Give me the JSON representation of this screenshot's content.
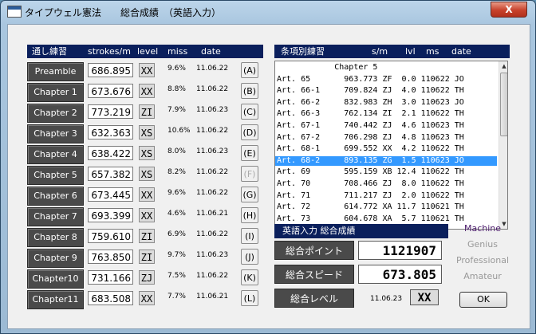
{
  "window": {
    "title": "タイプウェル憲法　　総合成績　（英語入力）",
    "close_glyph": "X"
  },
  "left_panel": {
    "headers": [
      "通し練習",
      "strokes/m",
      "level",
      "miss",
      "date"
    ],
    "rows": [
      {
        "label": "Preamble",
        "strokes": "686.895",
        "level": "XX",
        "miss": "9.6%",
        "date": "11.06.22",
        "key": "(A)",
        "key_enabled": true
      },
      {
        "label": "Chapter 1",
        "strokes": "673.676",
        "level": "XX",
        "miss": "8.8%",
        "date": "11.06.22",
        "key": "(B)",
        "key_enabled": true
      },
      {
        "label": "Chapter 2",
        "strokes": "773.219",
        "level": "ZI",
        "miss": "7.9%",
        "date": "11.06.23",
        "key": "(C)",
        "key_enabled": true
      },
      {
        "label": "Chapter 3",
        "strokes": "632.363",
        "level": "XS",
        "miss": "10.6%",
        "date": "11.06.22",
        "key": "(D)",
        "key_enabled": true
      },
      {
        "label": "Chapter 4",
        "strokes": "638.422",
        "level": "XS",
        "miss": "8.0%",
        "date": "11.06.23",
        "key": "(E)",
        "key_enabled": true
      },
      {
        "label": "Chapter 5",
        "strokes": "657.382",
        "level": "XS",
        "miss": "8.2%",
        "date": "11.06.22",
        "key": "(F)",
        "key_enabled": false
      },
      {
        "label": "Chapter 6",
        "strokes": "673.445",
        "level": "XX",
        "miss": "9.6%",
        "date": "11.06.22",
        "key": "(G)",
        "key_enabled": true
      },
      {
        "label": "Chapter 7",
        "strokes": "693.399",
        "level": "XX",
        "miss": "4.6%",
        "date": "11.06.21",
        "key": "(H)",
        "key_enabled": true
      },
      {
        "label": "Chapter 8",
        "strokes": "759.610",
        "level": "ZI",
        "miss": "6.9%",
        "date": "11.06.22",
        "key": "(I)",
        "key_enabled": true
      },
      {
        "label": "Chapter 9",
        "strokes": "763.850",
        "level": "ZI",
        "miss": "9.7%",
        "date": "11.06.23",
        "key": "(J)",
        "key_enabled": true
      },
      {
        "label": "Chapter10",
        "strokes": "731.166",
        "level": "ZJ",
        "miss": "7.5%",
        "date": "11.06.22",
        "key": "(K)",
        "key_enabled": true
      },
      {
        "label": "Chapter11",
        "strokes": "683.508",
        "level": "XX",
        "miss": "7.7%",
        "date": "11.06.21",
        "key": "(L)",
        "key_enabled": true
      }
    ]
  },
  "right_panel": {
    "headers": [
      "条項別練習",
      "s/m",
      "lvl",
      "ms",
      "date"
    ],
    "list": [
      {
        "text": "            Chapter 5",
        "selected": false
      },
      {
        "text": "Art. 65       963.773 ZF  0.0 110622 JO",
        "selected": false
      },
      {
        "text": "Art. 66-1     709.824 ZJ  4.0 110622 TH",
        "selected": false
      },
      {
        "text": "Art. 66-2     832.983 ZH  3.0 110623 JO",
        "selected": false
      },
      {
        "text": "Art. 66-3     762.134 ZI  2.1 110622 TH",
        "selected": false
      },
      {
        "text": "Art. 67-1     740.442 ZJ  4.6 110623 TH",
        "selected": false
      },
      {
        "text": "Art. 67-2     706.298 ZJ  4.8 110623 TH",
        "selected": false
      },
      {
        "text": "Art. 68-1     699.552 XX  4.2 110622 TH",
        "selected": false
      },
      {
        "text": "Art. 68-2     893.135 ZG  1.5 110623 JO",
        "selected": true
      },
      {
        "text": "Art. 69       595.159 XB 12.4 110622 TH",
        "selected": false
      },
      {
        "text": "Art. 70       708.466 ZJ  8.0 110622 TH",
        "selected": false
      },
      {
        "text": "Art. 71       711.217 ZJ  2.0 110622 TH",
        "selected": false
      },
      {
        "text": "Art. 72       614.772 XA 11.7 110621 TH",
        "selected": false
      },
      {
        "text": "Art. 73       604.678 XA  5.7 110621 TH",
        "selected": false
      }
    ],
    "scroll_up_glyph": "▲",
    "scroll_down_glyph": "▼"
  },
  "summary": {
    "title": "英語入力 総合成績",
    "points_label": "総合ポイント",
    "points_value": "1121907",
    "speed_label": "総合スピード",
    "speed_value": "673.805",
    "level_label": "総合レベル",
    "level_date": "11.06.23",
    "level_value": "XX"
  },
  "ranks": [
    {
      "label": "Machine",
      "active": true
    },
    {
      "label": "Genius",
      "active": false
    },
    {
      "label": "Professional",
      "active": false
    },
    {
      "label": "Amateur",
      "active": false
    }
  ],
  "ok_label": "OK",
  "colors": {
    "header_bg": "#0a1f5c",
    "button_bg": "#4a4a4a",
    "selection": "#3399ff",
    "rank_active": "#4a1a6a"
  }
}
